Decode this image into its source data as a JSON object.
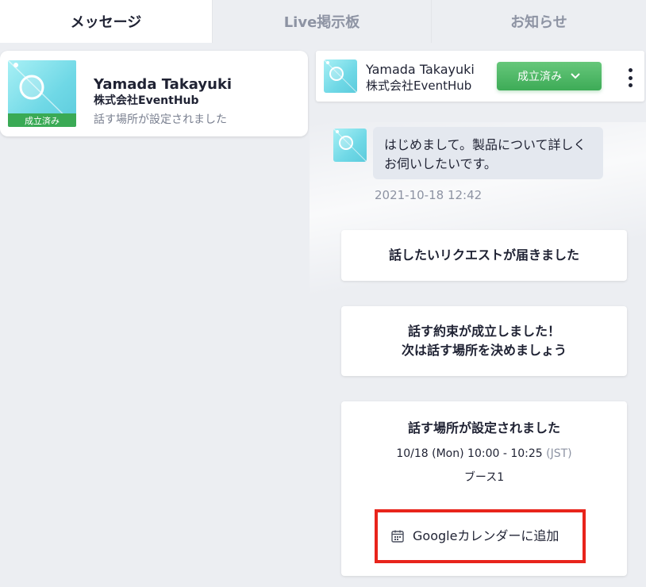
{
  "tabs": [
    {
      "label": "メッセージ",
      "active": true
    },
    {
      "label": "Live掲示板",
      "active": false
    },
    {
      "label": "お知らせ",
      "active": false
    }
  ],
  "conversation": {
    "name": "Yamada Takayuki",
    "company": "株式会社EventHub",
    "preview": "話す場所が設定されました",
    "badge": "成立済み"
  },
  "chat_header": {
    "name": "Yamada Takayuki",
    "company": "株式会社EventHub",
    "status_label": "成立済み",
    "status_icon": "chevron-down-icon",
    "menu_icon": "kebab-menu-icon"
  },
  "message": {
    "text": "はじめまして。製品について詳しくお伺いしたいです。",
    "timestamp": "2021-10-18 12:42"
  },
  "system_cards": {
    "request": "話したいリクエストが届きました",
    "agreed_line1": "話す約束が成立しました！",
    "agreed_line2": "次は話す場所を決めましょう",
    "location_title": "話す場所が設定されました",
    "schedule": "10/18 (Mon) 10:00 - 10:25",
    "timezone": "(JST)",
    "booth": "ブース1",
    "calendar_button": "Googleカレンダーに追加"
  },
  "colors": {
    "accent_green": "#3aaa55",
    "highlight_red": "#e8241b"
  }
}
